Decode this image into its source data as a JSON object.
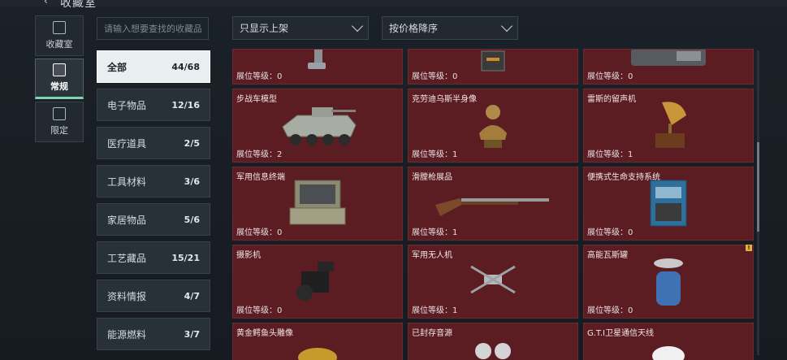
{
  "header": {
    "back_symbol": "‹",
    "title": "收藏室"
  },
  "rail": [
    {
      "label": "收藏室",
      "icon": "archive-icon"
    },
    {
      "label": "常规",
      "icon": "document-icon",
      "active": true
    },
    {
      "label": "限定",
      "icon": "picture-icon"
    }
  ],
  "search": {
    "placeholder": "请输入想要查找的收藏品"
  },
  "categories": [
    {
      "label": "全部",
      "count": "44/68",
      "active": true
    },
    {
      "label": "电子物品",
      "count": "12/16"
    },
    {
      "label": "医疗道具",
      "count": "2/5"
    },
    {
      "label": "工具材料",
      "count": "3/6"
    },
    {
      "label": "家居物品",
      "count": "5/6"
    },
    {
      "label": "工艺藏品",
      "count": "15/21"
    },
    {
      "label": "资料情报",
      "count": "4/7"
    },
    {
      "label": "能源燃料",
      "count": "3/7"
    }
  ],
  "filters": {
    "shelf": "只显示上架",
    "sort": "按价格降序"
  },
  "cards": [
    {
      "name": "",
      "level": "展位等级：0",
      "icon": "boot-icon"
    },
    {
      "name": "",
      "level": "展位等级：0",
      "icon": "radio-box-icon"
    },
    {
      "name": "",
      "level": "展位等级：0",
      "icon": "device-icon"
    },
    {
      "name": "步战车模型",
      "level": "展位等级：2",
      "icon": "ifv-model-icon"
    },
    {
      "name": "克劳迪乌斯半身像",
      "level": "展位等级：1",
      "icon": "bust-icon"
    },
    {
      "name": "雷斯的留声机",
      "level": "展位等级：1",
      "icon": "gramophone-icon"
    },
    {
      "name": "军用信息终端",
      "level": "展位等级：0",
      "icon": "terminal-case-icon"
    },
    {
      "name": "滑膛枪展品",
      "level": "展位等级：1",
      "icon": "musket-icon"
    },
    {
      "name": "便携式生命支持系统",
      "level": "展位等级：0",
      "icon": "life-support-icon"
    },
    {
      "name": "摄影机",
      "level": "展位等级：0",
      "icon": "camera-icon"
    },
    {
      "name": "军用无人机",
      "level": "展位等级：1",
      "icon": "drone-icon"
    },
    {
      "name": "高能瓦斯罐",
      "level": "展位等级：0",
      "icon": "gas-canister-icon",
      "badge": "!"
    },
    {
      "name": "黄金鳄鱼头雕像",
      "level": "",
      "icon": "croc-statue-icon"
    },
    {
      "name": "已封存音源",
      "level": "",
      "icon": "reel-icon"
    },
    {
      "name": "G.T.I卫星通信天线",
      "level": "",
      "icon": "antenna-icon"
    }
  ],
  "colors": {
    "card_bg": "#5b1c22",
    "accent": "#7fd2b4",
    "badge": "#e0b43a"
  }
}
